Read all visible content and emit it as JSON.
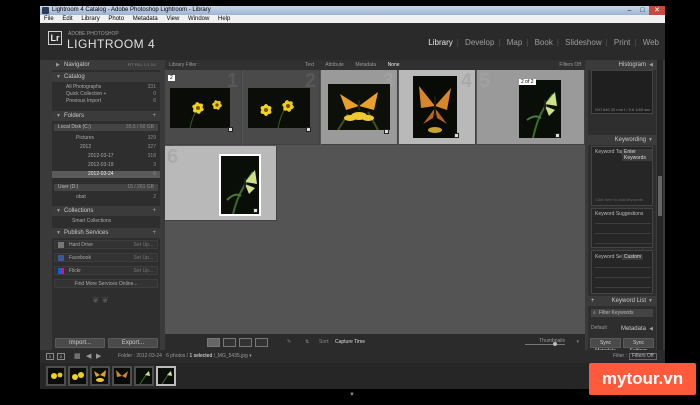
{
  "window": {
    "title": "Lightroom 4 Catalog - Adobe Photoshop Lightroom - Library",
    "controls": [
      "minimize-icon",
      "maximize-icon",
      "close-icon"
    ]
  },
  "menu": [
    "File",
    "Edit",
    "Library",
    "Photo",
    "Metadata",
    "View",
    "Window",
    "Help"
  ],
  "brand": {
    "logo": "Lr",
    "subtitle": "ADOBE PHOTOSHOP",
    "product": "LIGHTROOM 4"
  },
  "modules": {
    "items": [
      "Library",
      "Develop",
      "Map",
      "Book",
      "Slideshow",
      "Print",
      "Web"
    ],
    "active": "Library"
  },
  "left_panel": {
    "navigator": {
      "label": "Navigator",
      "zoom": [
        "FIT",
        "FILL",
        "1:1",
        "3:1"
      ]
    },
    "catalog": {
      "label": "Catalog",
      "items": [
        {
          "label": "All Photographs",
          "count": "331"
        },
        {
          "label": "Quick Collection +",
          "count": "0"
        },
        {
          "label": "Previous Import",
          "count": "6"
        }
      ]
    },
    "folders": {
      "label": "Folders",
      "volume1": {
        "label": "Local Disk (C:)",
        "space": "35.5 / 60 GB"
      },
      "items": [
        {
          "label": "Pictures",
          "count": "329"
        },
        {
          "label": "2012",
          "count": "327"
        },
        {
          "label": "2012-03-17",
          "count": "318"
        },
        {
          "label": "2012-03-19",
          "count": "3"
        },
        {
          "label": "2012-03-24",
          "count": "6"
        }
      ],
      "volume2": {
        "label": "User (D:)",
        "space": "15 / 261 GB"
      },
      "volume2_items": [
        {
          "label": "obat",
          "count": "2"
        }
      ]
    },
    "collections": {
      "label": "Collections",
      "items": [
        {
          "label": "Smart Collections"
        }
      ]
    },
    "publish": {
      "label": "Publish Services",
      "items": [
        {
          "label": "Hard Drive",
          "action": "Set Up..."
        },
        {
          "label": "Facebook",
          "action": "Set Up..."
        },
        {
          "label": "Flickr",
          "action": "Set Up..."
        }
      ],
      "find_more": "Find More Services Online..."
    },
    "import_label": "Import...",
    "export_label": "Export..."
  },
  "library_filter": {
    "label": "Library Filter :",
    "options": [
      "Text",
      "Attribute",
      "Metadata",
      "None"
    ],
    "active": "None",
    "filters_off": "Filters Off"
  },
  "grid": {
    "cells": [
      {
        "number": "1",
        "tag": "2",
        "subject": "two-yellow-flowers",
        "selected": false
      },
      {
        "number": "2",
        "tag": "",
        "subject": "yellow-flowers",
        "selected": false
      },
      {
        "number": "3",
        "tag": "",
        "subject": "butterfly-on-flower",
        "selected": true
      },
      {
        "number": "4",
        "tag": "",
        "subject": "butterfly-portrait",
        "selected": true
      },
      {
        "number": "5",
        "tag": "2 of 2",
        "subject": "butterfly-on-plant",
        "selected": true
      },
      {
        "number": "6",
        "tag": "",
        "subject": "butterfly-on-plant",
        "selected": true
      }
    ]
  },
  "toolbar": {
    "sort_label": "Sort:",
    "sort_value": "Capture Time",
    "thumbnails_label": "Thumbnails"
  },
  "right_panel": {
    "histogram": {
      "label": "Histogram",
      "info": [
        "ISO 640",
        "20 mm",
        "f / 5.6",
        "1/60 sec"
      ]
    },
    "keywording": {
      "label": "Keywording",
      "tags_label": "Keyword Tags",
      "tags_value": "Enter Keywords",
      "hint": "Click here to add keywords",
      "suggestions_label": "Keyword Suggestions",
      "set_label": "Keyword Set",
      "set_value": "Custom"
    },
    "keyword_list": {
      "label": "Keyword List",
      "filter": "Filter Keywords"
    },
    "metadata": {
      "label": "Metadata",
      "preset": "Default"
    },
    "sync_metadata": "Sync Metadata",
    "sync_settings": "Sync Settings"
  },
  "filmstrip": {
    "monitors": [
      "1",
      "2"
    ],
    "path": "Folder : 2012-03-24",
    "count": "6 photos /",
    "selected": "1 selected",
    "file": "/_MG_5435.jpg",
    "filter_label": "Filter :",
    "filter_value": "Filters Off",
    "selected_index": 5
  },
  "watermark": "mytour.vn"
}
